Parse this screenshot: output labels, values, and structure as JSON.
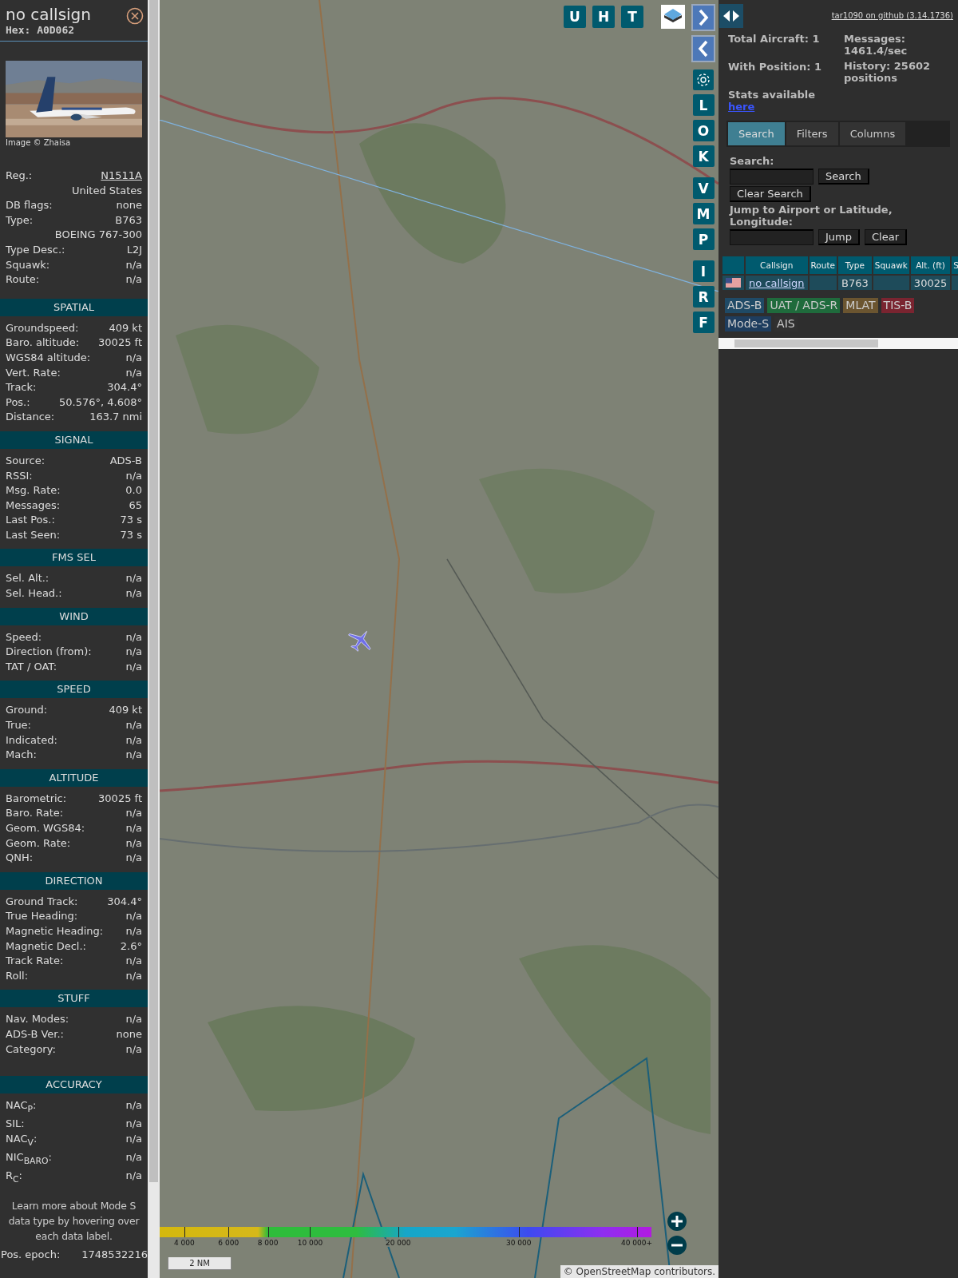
{
  "aircraft": {
    "title": "no callsign",
    "hex": "Hex: A0D062",
    "photo_credit": "Image © Zhaisa",
    "sections": [
      {
        "rows": [
          {
            "label": "Reg.:",
            "value": "N1511A",
            "link": true
          },
          {
            "value": "United States"
          },
          {
            "label": "DB flags:",
            "value": "none"
          },
          {
            "label": "Type:",
            "value": "B763"
          },
          {
            "value": "BOEING 767-300"
          },
          {
            "label": "Type Desc.:",
            "value": "L2J"
          },
          {
            "label": "Squawk:",
            "value": "n/a"
          },
          {
            "label": "Route:",
            "value": "n/a"
          }
        ]
      },
      {
        "title": "SPATIAL",
        "rows": [
          {
            "label": "Groundspeed:",
            "value": "409 kt"
          },
          {
            "label": "Baro. altitude:",
            "value": "30025 ft"
          },
          {
            "label": "WGS84 altitude:",
            "value": "n/a"
          },
          {
            "label": "Vert. Rate:",
            "value": "n/a"
          },
          {
            "label": "Track:",
            "value": "304.4°"
          },
          {
            "label": "Pos.:",
            "value": "50.576°, 4.608°"
          },
          {
            "label": "Distance:",
            "value": "163.7 nmi"
          }
        ]
      },
      {
        "title": "SIGNAL",
        "rows": [
          {
            "label": "Source:",
            "value": "ADS-B"
          },
          {
            "label": "RSSI:",
            "value": "n/a"
          },
          {
            "label": "Msg. Rate:",
            "value": "0.0"
          },
          {
            "label": "Messages:",
            "value": "65"
          },
          {
            "label": "Last Pos.:",
            "value": "73 s"
          },
          {
            "label": "Last Seen:",
            "value": "73 s"
          }
        ]
      },
      {
        "title": "FMS SEL",
        "rows": [
          {
            "label": "Sel. Alt.:",
            "value": "n/a"
          },
          {
            "label": "Sel. Head.:",
            "value": "n/a"
          }
        ]
      },
      {
        "title": "WIND",
        "rows": [
          {
            "label": "Speed:",
            "value": "n/a"
          },
          {
            "label": "Direction (from):",
            "value": "n/a"
          },
          {
            "label": "TAT / OAT:",
            "value": "n/a"
          }
        ]
      },
      {
        "title": "SPEED",
        "rows": [
          {
            "label": "Ground:",
            "value": "409 kt"
          },
          {
            "label": "True:",
            "value": "n/a"
          },
          {
            "label": "Indicated:",
            "value": "n/a"
          },
          {
            "label": "Mach:",
            "value": "n/a"
          }
        ]
      },
      {
        "title": "ALTITUDE",
        "rows": [
          {
            "label": "Barometric:",
            "value": "30025 ft"
          },
          {
            "label": "Baro. Rate:",
            "value": "n/a"
          },
          {
            "label": "Geom. WGS84:",
            "value": "n/a"
          },
          {
            "label": "Geom. Rate:",
            "value": "n/a"
          },
          {
            "label": "QNH:",
            "value": "n/a"
          }
        ]
      },
      {
        "title": "DIRECTION",
        "rows": [
          {
            "label": "Ground Track:",
            "value": "304.4°"
          },
          {
            "label": "True Heading:",
            "value": "n/a"
          },
          {
            "label": "Magnetic Heading:",
            "value": "n/a"
          },
          {
            "label": "Magnetic Decl.:",
            "value": "2.6°"
          },
          {
            "label": "Track Rate:",
            "value": "n/a"
          },
          {
            "label": "Roll:",
            "value": "n/a"
          }
        ]
      },
      {
        "title": "STUFF",
        "rows": [
          {
            "label": "Nav. Modes:",
            "value": "n/a"
          },
          {
            "label": "ADS-B Ver.:",
            "value": "none"
          },
          {
            "label": "Category:",
            "value": "n/a"
          }
        ]
      },
      {
        "title": "ACCURACY",
        "rows": [
          {
            "label": "NAC$_{P}$:",
            "value": "n/a"
          },
          {
            "label": "SIL:",
            "value": "n/a"
          },
          {
            "label": "NAC$_{V}$:",
            "value": "n/a"
          },
          {
            "label": "NIC$_{BARO}$:",
            "value": "n/a"
          },
          {
            "label": "R$_{C}$:",
            "value": "n/a"
          }
        ]
      }
    ],
    "note": "Learn more about Mode S data type by hovering over each data label.",
    "epoch": {
      "label": "Pos. epoch:",
      "value": "1748532216"
    }
  },
  "map": {
    "top_buttons": [
      "U",
      "H",
      "T"
    ],
    "side_buttons": [
      {
        "kind": "next"
      },
      {
        "kind": "prev"
      },
      {
        "kind": "settings"
      },
      {
        "kind": "letter",
        "label": "L"
      },
      {
        "kind": "letter",
        "label": "O"
      },
      {
        "kind": "letter",
        "label": "K"
      },
      {
        "kind": "letter",
        "label": "V"
      },
      {
        "kind": "letter",
        "label": "M"
      },
      {
        "kind": "letter",
        "label": "P"
      },
      {
        "kind": "letter",
        "label": "I"
      },
      {
        "kind": "letter",
        "label": "R"
      },
      {
        "kind": "letter",
        "label": "F"
      }
    ],
    "altitude_scale": [
      "4 000",
      "6 000",
      "8 000",
      "10 000",
      "20 000",
      "30 000",
      "40 000+"
    ],
    "scale": "2 NM",
    "attribution": "© OpenStreetMap contributors."
  },
  "panel": {
    "version_link": "tar1090 on github (3.14.1736)",
    "stats_left": [
      "Total Aircraft: 1",
      "With Position: 1"
    ],
    "stats_link_label": "Stats available",
    "stats_link": "here",
    "stats_right": [
      "Messages: 1461.4/sec",
      "History: 25602 positions"
    ],
    "tabs": [
      {
        "label": "Search",
        "selected": true
      },
      {
        "label": "Filters",
        "selected": false
      },
      {
        "label": "Columns",
        "selected": false
      }
    ],
    "search_label": "Search:",
    "search_button": "Search",
    "clear_search_button": "Clear Search",
    "jump_label": "Jump to Airport or Latitude, Longitude:",
    "jump_button": "Jump",
    "clear_button": "Clear",
    "table": {
      "columns": [
        "Callsign",
        "Route",
        "Type",
        "Squawk",
        "Alt. (ft)",
        "S"
      ],
      "rows": [
        {
          "callsign": "no callsign",
          "type": "B763",
          "altitude": "30025"
        }
      ]
    },
    "legend": [
      {
        "label": "ADS-B",
        "color": "#1f4a66"
      },
      {
        "label": "UAT / ADS-R",
        "color": "#1f6b3c"
      },
      {
        "label": "MLAT",
        "color": "#6b5530"
      },
      {
        "label": "TIS-B",
        "color": "#7a2430"
      },
      {
        "label": "Mode-S",
        "color": "#1e3d5e"
      },
      {
        "label": "AIS",
        "color": "#303030"
      }
    ]
  }
}
